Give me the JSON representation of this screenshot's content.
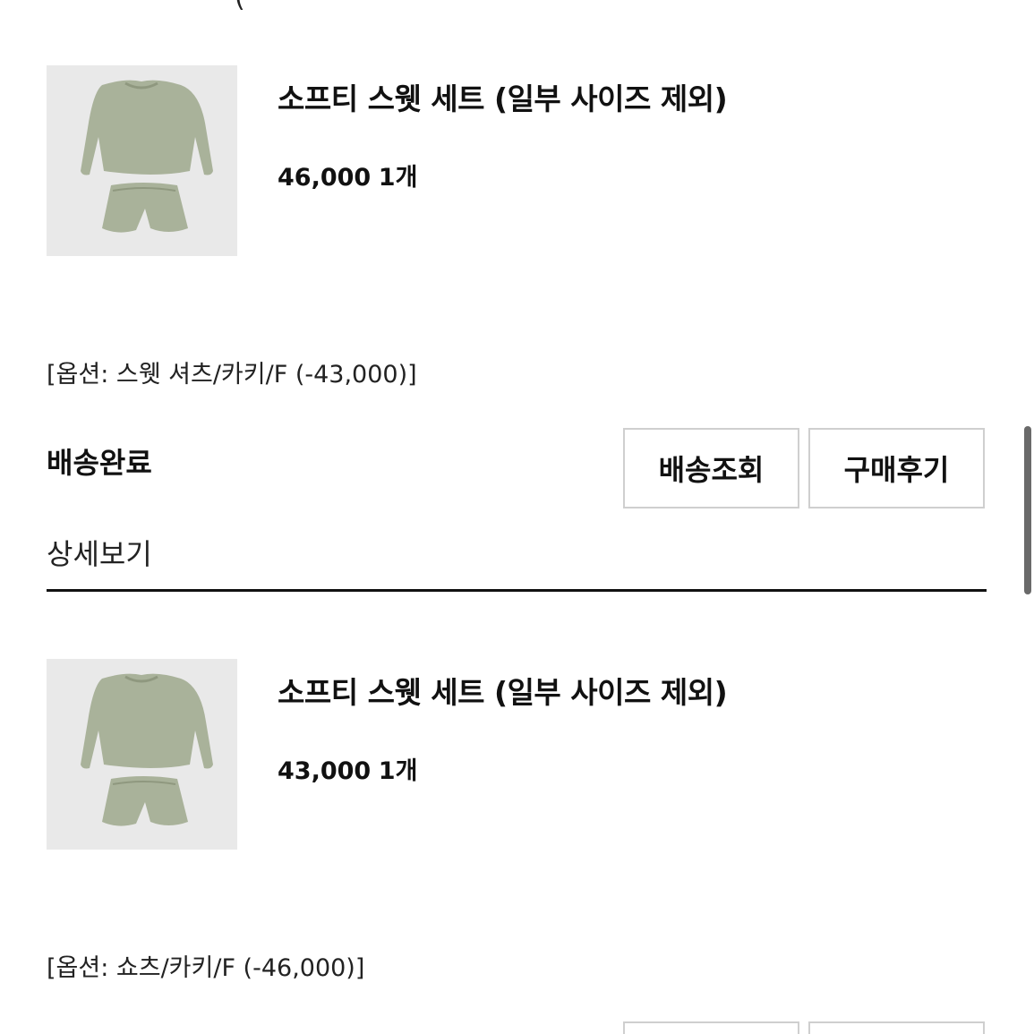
{
  "orders": [
    {
      "product_name": "소프티 스웻 세트 (일부 사이즈 제외)",
      "price": "46,000",
      "quantity": "1개",
      "option": "[옵션: 스웻 셔츠/카키/F (-43,000)]",
      "status": "배송완료",
      "track_button": "배송조회",
      "review_button": "구매후기",
      "detail_link": "상세보기"
    },
    {
      "product_name": "소프티 스웻 세트 (일부 사이즈 제외)",
      "price": "43,000",
      "quantity": "1개",
      "option": "[옵션: 쇼츠/카키/F (-46,000)]"
    }
  ],
  "colors": {
    "product_khaki": "#a9b29a",
    "thumb_bg": "#e9e9e9",
    "button_border": "#cfcfcf",
    "divider": "#111111"
  }
}
